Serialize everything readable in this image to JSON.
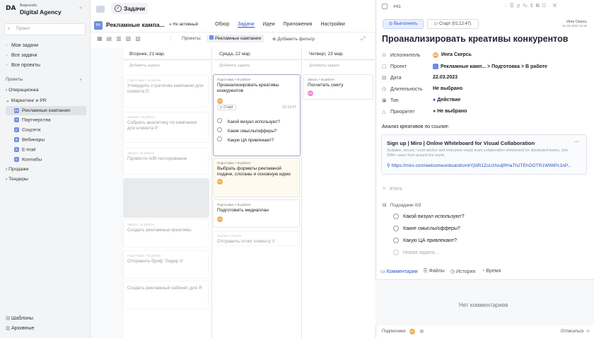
{
  "sidebar": {
    "logo": "DA",
    "brand_small": "Вокросейс",
    "brand": "Digital Agency",
    "search_placeholder": "Проект",
    "nav": [
      "Мои задачи",
      "Все задачи",
      "Все проекты"
    ],
    "projects_label": "Проекты",
    "tree": [
      {
        "label": "Операционка",
        "level": 0
      },
      {
        "label": "Маркетинг и PR",
        "level": 0
      },
      {
        "label": "Рекламные кампании",
        "level": 1,
        "active": true
      },
      {
        "label": "Партнерства",
        "level": 1
      },
      {
        "label": "Соцсети",
        "level": 1
      },
      {
        "label": "Вебинары",
        "level": 1
      },
      {
        "label": "E-mail",
        "level": 1
      },
      {
        "label": "Коллабы",
        "level": 1
      },
      {
        "label": "Продажи",
        "level": 0
      },
      {
        "label": "Тендеры",
        "level": 0
      }
    ],
    "bottom": [
      "Шаблоны",
      "Архивные"
    ]
  },
  "topbar": {
    "tasks_label": "Задачи",
    "project_title": "Рекламные кампа...",
    "status": "Не активный",
    "tabs": [
      "Обзор",
      "Задачи",
      "Идеи",
      "Приложения",
      "Настройки"
    ],
    "projects_filter_label": "Проекты:",
    "project_chip": "Рекламные кампании",
    "add_filter": "Добавить фильтр"
  },
  "board": {
    "days": [
      "Вторник, 21 мар.",
      "Среда, 22 мар.",
      "Четверг, 23 мар."
    ],
    "add_task": "Добавить задачу",
    "col1": [
      {
        "meta": "Подготовка > В работе",
        "title": "Утвердить стратегию кампании для клиента П",
        "dim": true
      },
      {
        "meta": "Анализ > В работе",
        "title": "Собрать аналитику по кампании для клиента Р",
        "dim": true
      },
      {
        "meta": "Запуск > В работе",
        "title": "Провести A/B-тестирование",
        "dim": true
      },
      {
        "meta": "Запуск > В работе",
        "title": "Создать рекламные креативы",
        "dim": true
      },
      {
        "meta": "Подготовка > В работе",
        "title": "Отправить бриф 'Лидер X'",
        "dim": true
      },
      {
        "meta": "",
        "title": "Создать рекламный кабинет для Я",
        "dim": true
      }
    ],
    "col2": [
      {
        "meta": "Подготовка > В работе",
        "title": "Проанализировать креативы конкурентов",
        "start": "Старт",
        "time": "01:12:47",
        "subtasks": [
          "Какой визуал используют?",
          "Какие смыслы/офферы?",
          "Какую ЦА привлекают?"
        ]
      },
      {
        "meta": "Подготовка > В работе",
        "title": "Выбрать форматы рекламной подачи, слоганы и основную идею"
      },
      {
        "meta": "Подготовка > В работе",
        "title": "Подготовить медиаплан"
      },
      {
        "meta": "Анализ > Готово",
        "title": "Отправить отчет клиенту У",
        "dim": true
      }
    ],
    "col3": [
      {
        "meta": "Запуск > В работе",
        "title": "Посчитать смету"
      }
    ]
  },
  "panel": {
    "id": "#41",
    "execute": "Выполнить",
    "start": "Старт (01:12:47)",
    "author_name": "Инга Скерсь",
    "author_date": "21.03.2023 16:16",
    "title": "Проанализировать креативы конкурентов",
    "fields": [
      {
        "label": "Исполнитель",
        "value": "Инга Скерсь"
      },
      {
        "label": "Проект",
        "value": "Рекламные камп... > Подготовка > В работе"
      },
      {
        "label": "Дата",
        "value": "22.03.2023"
      },
      {
        "label": "Длительность",
        "value": "Не выбрано"
      },
      {
        "label": "Тип",
        "value": "Действие"
      },
      {
        "label": "Приоритет",
        "value": "Не выбрано"
      }
    ],
    "description": "Анализ креативов по ссылке:",
    "link": {
      "title": "Sign up | Miro | Online Whiteboard for Visual Collaboration",
      "desc": "Scalable, secure, cross-device and enterprise-ready team collaboration whiteboard for distributed teams. Join 35M+ users from around the world.",
      "url": "https://miro.com/welcomeonboard/cmlIYjl3R1ZoUzhsdjRHaTh2TEhOOTR1WWtPc1hP..."
    },
    "tags": "#теги",
    "subtasks_label": "Подзадачи 0/3",
    "subtasks": [
      "Какой визуал используют?",
      "Какие смыслы/офферы?",
      "Какую ЦА привлекают?"
    ],
    "new_subtask": "Новая задача...",
    "tabs": [
      "Комментарии",
      "Файлы",
      "История",
      "Время"
    ],
    "no_comments": "Нет комментариев",
    "subscribers": "Подписчики:",
    "unsubscribe": "Отписаться"
  }
}
